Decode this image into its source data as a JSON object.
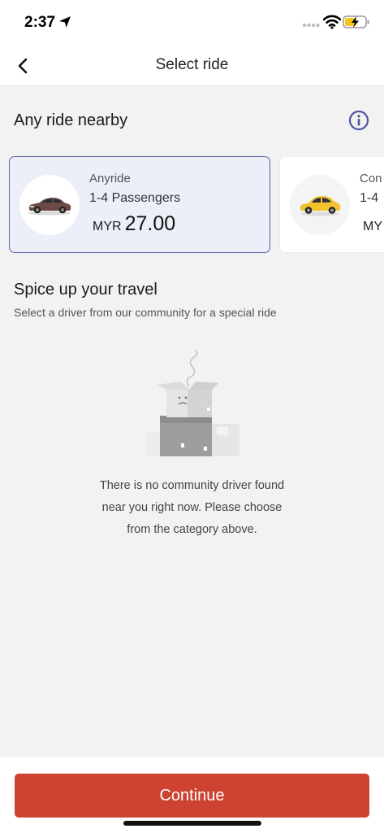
{
  "status_bar": {
    "time": "2:37",
    "icons": [
      "location-arrow-icon",
      "signal-icon",
      "wifi-icon",
      "battery-charging-icon"
    ]
  },
  "nav": {
    "title": "Select ride",
    "back_icon": "chevron-left-icon"
  },
  "rides_section": {
    "title": "Any ride nearby",
    "info_icon": "info-icon",
    "cards": [
      {
        "name": "Anyride",
        "passengers": "1-4 Passengers",
        "currency": "MYR",
        "price": "27.00",
        "car_icon": "brown-sedan-icon",
        "selected": true
      },
      {
        "name": "Con",
        "passengers": "1-4",
        "currency": "MY",
        "price": "",
        "car_icon": "yellow-hatchback-icon",
        "selected": false
      }
    ]
  },
  "community_section": {
    "title": "Spice up your travel",
    "subtitle": "Select a driver from our community for a special ride",
    "empty_illustration": "empty-boxes-illustration",
    "empty_lines": [
      "There is no community driver found",
      "near you right now. Please choose",
      "from the category above."
    ]
  },
  "footer": {
    "continue_label": "Continue"
  },
  "colors": {
    "accent_button": "#cd4230",
    "selected_card_bg": "#eceef8",
    "selected_card_border": "#5a62a8",
    "info_icon": "#4b55a0",
    "background": "#f2f2f2"
  }
}
